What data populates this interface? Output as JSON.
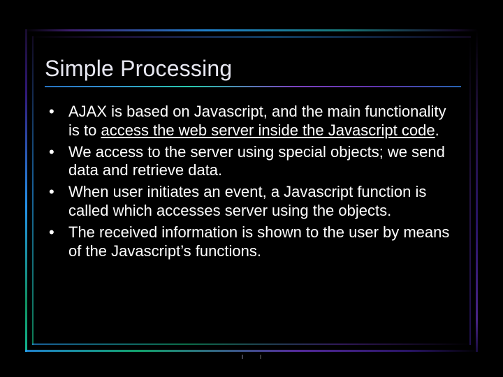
{
  "slide": {
    "title": "Simple Processing",
    "bullets": [
      {
        "pre": "AJAX is based on Javascript, and the main functionality is to ",
        "underlined": "access the web server inside the Javascript code",
        "post": "."
      },
      {
        "pre": "We access to the server using special objects; we send data and retrieve data.",
        "underlined": "",
        "post": ""
      },
      {
        "pre": "When user initiates an event, a Javascript function is called which accesses server using the objects.",
        "underlined": "",
        "post": ""
      },
      {
        "pre": "The received information is shown to the user by means of the Javascript’s functions.",
        "underlined": "",
        "post": ""
      }
    ]
  }
}
